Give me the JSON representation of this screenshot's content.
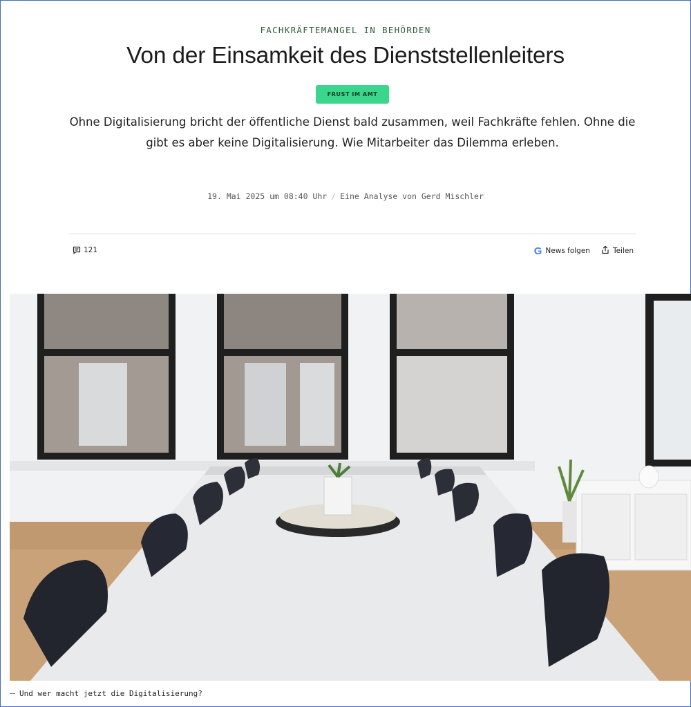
{
  "article": {
    "kicker": "FACHKRÄFTEMANGEL IN BEHÖRDEN",
    "headline": "Von der Einsamkeit des Dienststellenleiters",
    "badge": "FRUST IM AMT",
    "teaser": "Ohne Digitalisierung bricht der öffentliche Dienst bald zusammen, weil Fachkräfte fehlen. Ohne die gibt es aber keine Digitalisierung. Wie Mitarbeiter das Dilemma erleben.",
    "date": "19. Mai 2025 um 08:40 Uhr",
    "separator": "/",
    "author": "Eine Analyse von Gerd Mischler",
    "image_caption": "Und wer macht jetzt die Digitalisierung?"
  },
  "toolbar": {
    "comment_count": "121",
    "news_follow": "News folgen",
    "share": "Teilen",
    "icons": {
      "comments": "comment-icon",
      "google": "google-icon",
      "share": "share-icon"
    }
  },
  "colors": {
    "badge_bg": "#3ad68b",
    "kicker": "#2e5d38",
    "google_blue": "#4285f4"
  }
}
